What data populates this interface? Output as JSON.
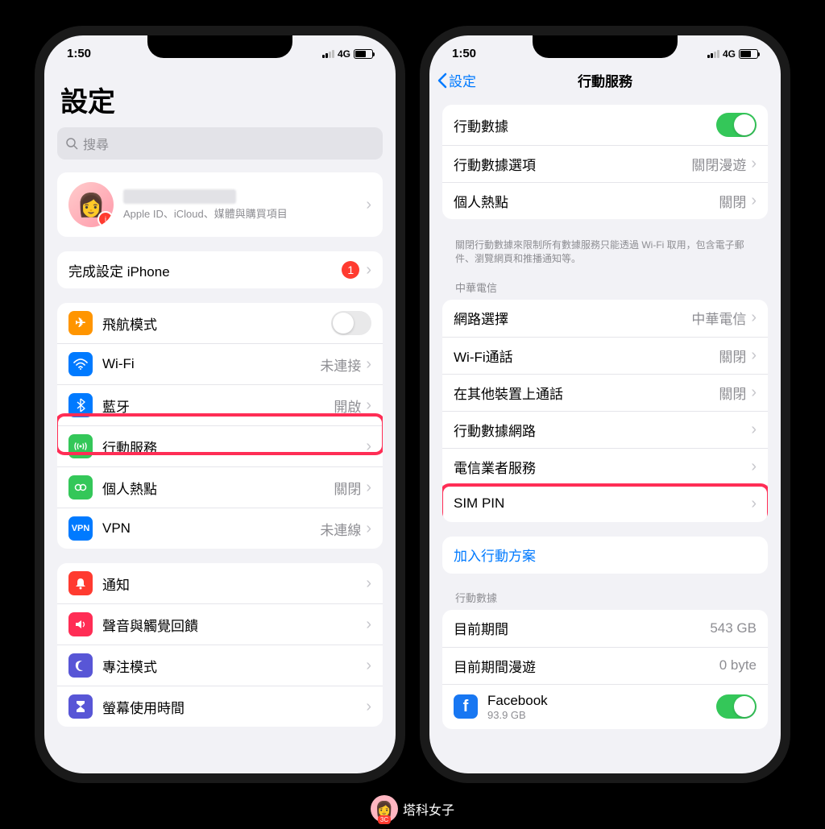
{
  "status": {
    "time": "1:50",
    "network": "4G"
  },
  "left": {
    "title": "設定",
    "search_placeholder": "搜尋",
    "profile_sub": "Apple ID、iCloud、媒體與購買項目",
    "finish_setup": {
      "label": "完成設定 iPhone",
      "badge": "1"
    },
    "group1": {
      "airplane": "飛航模式",
      "wifi": {
        "label": "Wi-Fi",
        "value": "未連接"
      },
      "bluetooth": {
        "label": "藍牙",
        "value": "開啟"
      },
      "cellular": "行動服務",
      "hotspot": {
        "label": "個人熱點",
        "value": "關閉"
      },
      "vpn": {
        "label": "VPN",
        "value": "未連線"
      }
    },
    "group2": {
      "notifications": "通知",
      "sounds": "聲音與觸覺回饋",
      "focus": "專注模式",
      "screentime": "螢幕使用時間"
    }
  },
  "right": {
    "back": "設定",
    "title": "行動服務",
    "group1": {
      "data": "行動數據",
      "options": {
        "label": "行動數據選項",
        "value": "關閉漫遊"
      },
      "hotspot": {
        "label": "個人熱點",
        "value": "關閉"
      }
    },
    "footer1": "關閉行動數據來限制所有數據服務只能透過 Wi-Fi 取用，包含電子郵件、瀏覽網頁和推播通知等。",
    "carrier_header": "中華電信",
    "group2": {
      "network": {
        "label": "網路選擇",
        "value": "中華電信"
      },
      "wificall": {
        "label": "Wi-Fi通話",
        "value": "關閉"
      },
      "other_devices": {
        "label": "在其他裝置上通話",
        "value": "關閉"
      },
      "data_network": "行動數據網路",
      "carrier_services": "電信業者服務",
      "sim_pin": "SIM PIN"
    },
    "add_plan": "加入行動方案",
    "data_header": "行動數據",
    "group3": {
      "current": {
        "label": "目前期間",
        "value": "543 GB"
      },
      "roaming": {
        "label": "目前期間漫遊",
        "value": "0 byte"
      },
      "facebook": {
        "label": "Facebook",
        "size": "93.9 GB"
      }
    }
  },
  "watermark": "塔科女子"
}
